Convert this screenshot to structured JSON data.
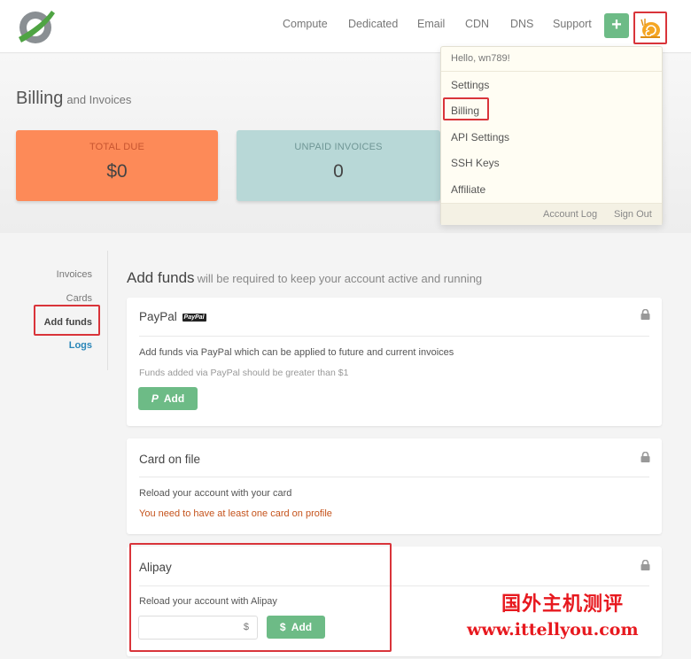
{
  "header": {
    "nav": [
      "Compute",
      "Dedicated",
      "Email",
      "CDN",
      "DNS",
      "Support"
    ],
    "add_label": "+",
    "colors": {
      "accent_green": "#6dbb86",
      "highlight_red": "#d9343a"
    }
  },
  "page": {
    "title": "Billing",
    "subtitle": "and Invoices"
  },
  "stats": {
    "total_due": {
      "label": "TOTAL DUE",
      "value": "$0",
      "color": "#fd8a58"
    },
    "unpaid": {
      "label": "UNPAID INVOICES",
      "value": "0",
      "color": "#b8d8d7"
    }
  },
  "dropdown": {
    "greeting": "Hello, wn789!",
    "items": [
      "Settings",
      "Billing",
      "API Settings",
      "SSH Keys",
      "Affiliate"
    ],
    "footer": [
      "Account Log",
      "Sign Out"
    ]
  },
  "sidebar": {
    "items": [
      "Invoices",
      "Cards",
      "Add funds",
      "Logs"
    ]
  },
  "section": {
    "title": "Add funds",
    "subtitle": "will be required to keep your account active and running"
  },
  "paypal": {
    "title": "PayPal",
    "badge": "PayPal",
    "text": "Add funds via PayPal which can be applied to future and current invoices",
    "note": "Funds added via PayPal should be greater than $1",
    "button": "Add",
    "button_icon": "paypal-icon"
  },
  "card_on_file": {
    "title": "Card on file",
    "text": "Reload your account with your card",
    "warning": "You need to have at least one card on profile"
  },
  "alipay": {
    "title": "Alipay",
    "text": "Reload your account with Alipay",
    "amount_value": "",
    "currency": "$",
    "button": "$  Add"
  },
  "watermark": {
    "line1": "国外主机测评",
    "line2": "www.ittellyou.com"
  }
}
